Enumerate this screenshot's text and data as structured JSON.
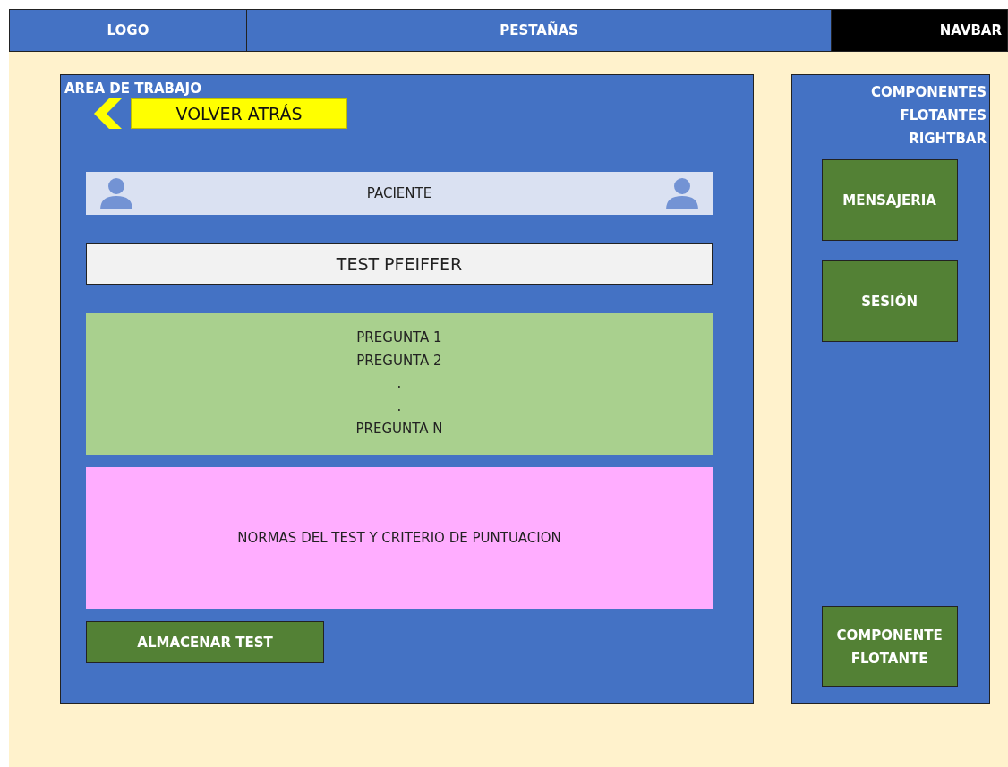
{
  "header": {
    "logo": "LOGO",
    "tabs": "PESTAÑAS",
    "navbar": "NAVBAR"
  },
  "work_area": {
    "title": "AREA DE TRABAJO",
    "back_button": "VOLVER ATRÁS",
    "patient_bar": "PACIENTE",
    "test_title": "TEST PFEIFFER",
    "questions": [
      "PREGUNTA 1",
      "PREGUNTA 2",
      ".",
      ".",
      "PREGUNTA N"
    ],
    "rules": "NORMAS DEL TEST Y CRITERIO DE PUNTUACION",
    "save_button": "ALMACENAR TEST"
  },
  "rightbar": {
    "title_lines": [
      "COMPONENTES",
      "FLOTANTES",
      "RIGHTBAR"
    ],
    "buttons": [
      {
        "label": "MENSAJERIA"
      },
      {
        "label": "SESIÓN"
      }
    ],
    "floating_component": "COMPONENTE FLOTANTE"
  }
}
